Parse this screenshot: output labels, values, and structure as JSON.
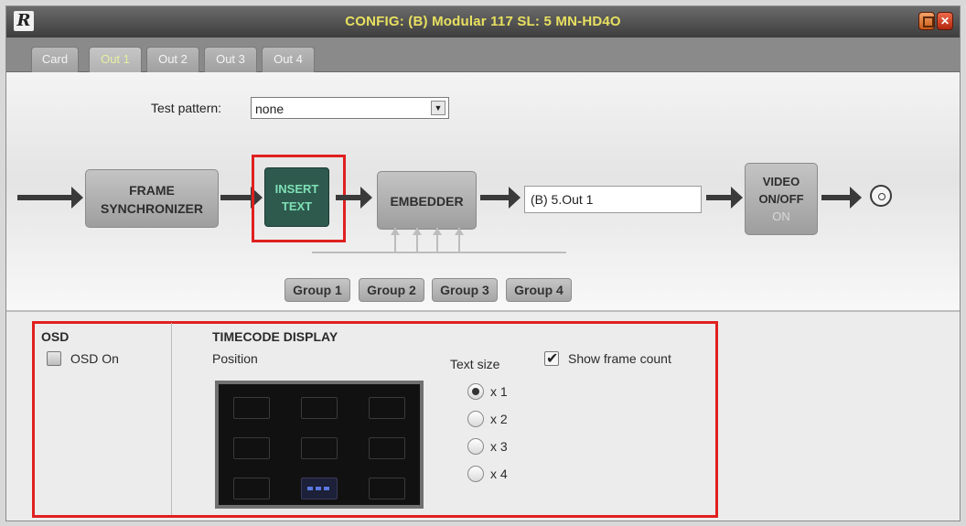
{
  "window": {
    "title": "CONFIG: (B) Modular 117 SL: 5 MN-HD4O",
    "logo_text": "R",
    "minimize_icon": "minimize-icon",
    "close_label": "✕"
  },
  "tabs": [
    {
      "label": "Card",
      "active": false
    },
    {
      "label": "Out 1",
      "active": true
    },
    {
      "label": "Out 2",
      "active": false
    },
    {
      "label": "Out 3",
      "active": false
    },
    {
      "label": "Out 4",
      "active": false
    }
  ],
  "test_pattern": {
    "label": "Test pattern:",
    "value": "none"
  },
  "pipeline": {
    "frame_sync": [
      "FRAME",
      "SYNCHRONIZER"
    ],
    "insert_text": [
      "INSERT",
      "TEXT"
    ],
    "embedder": "EMBEDDER",
    "output_name": "(B) 5.Out 1",
    "video_onoff": [
      "VIDEO",
      "ON/OFF",
      "ON"
    ],
    "groups": [
      "Group 1",
      "Group 2",
      "Group 3",
      "Group 4"
    ]
  },
  "osd": {
    "heading": "OSD",
    "checkbox_label": "OSD On",
    "checked": false
  },
  "timecode": {
    "heading": "TIMECODE DISPLAY",
    "position_label": "Position",
    "selected_position": "bottom-center",
    "text_size_label": "Text size",
    "sizes": [
      {
        "label": "x 1",
        "selected": true
      },
      {
        "label": "x 2",
        "selected": false
      },
      {
        "label": "x 3",
        "selected": false
      },
      {
        "label": "x 4",
        "selected": false
      }
    ],
    "show_frame_count_label": "Show frame count",
    "show_frame_count": true
  },
  "colors": {
    "highlight": "#e02020",
    "title_text": "#e8e060",
    "insert_block": "#2e5a4e"
  }
}
